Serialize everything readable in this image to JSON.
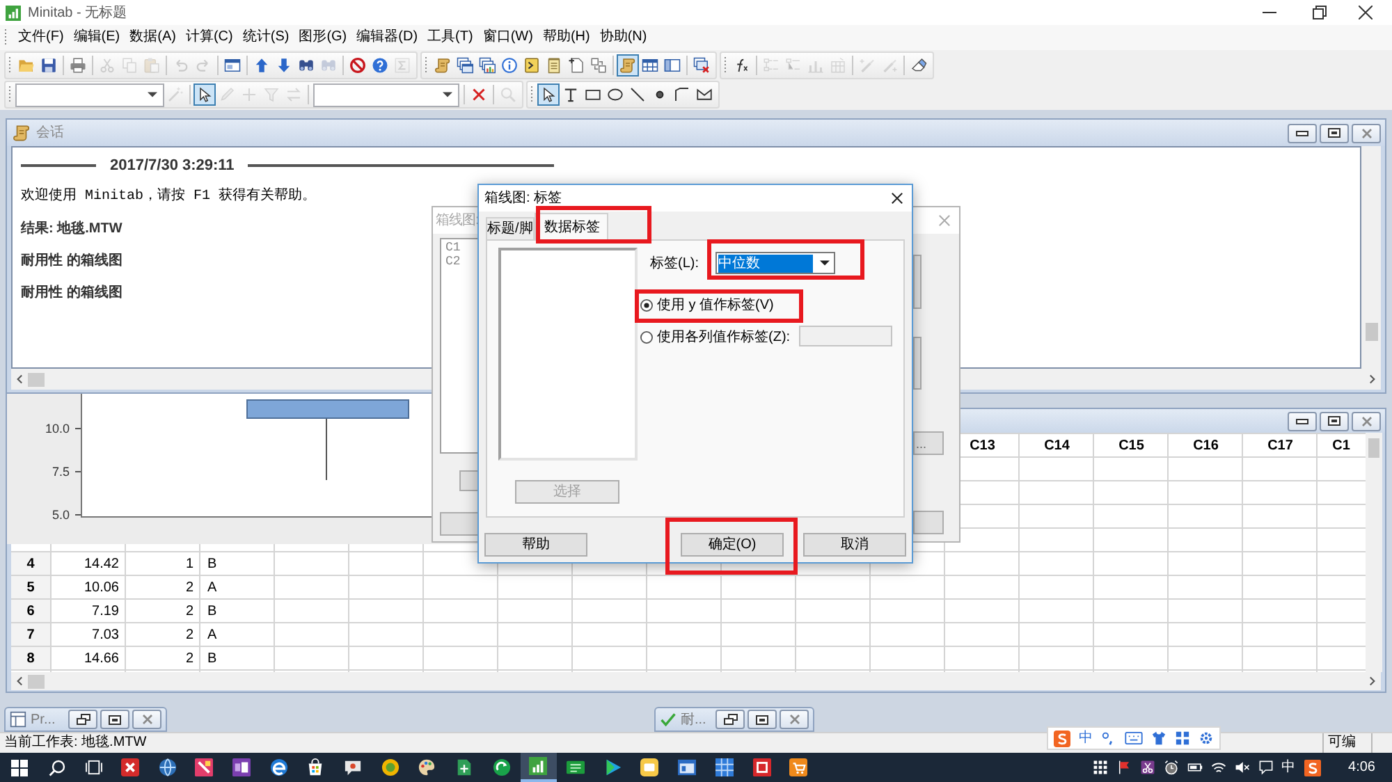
{
  "window": {
    "title": "Minitab - 无标题"
  },
  "menu": [
    "文件(F)",
    "编辑(E)",
    "数据(A)",
    "计算(C)",
    "统计(S)",
    "图形(G)",
    "编辑器(D)",
    "工具(T)",
    "窗口(W)",
    "帮助(H)",
    "协助(N)"
  ],
  "toolbars": [
    {
      "buttons": [
        {
          "disabled": false,
          "pressed": false
        },
        {
          "disabled": false,
          "pressed": false
        },
        {
          "disabled": false,
          "pressed": false
        },
        {
          "disabled": true,
          "pressed": false
        },
        {
          "disabled": true,
          "pressed": false
        },
        {
          "disabled": true,
          "pressed": false
        },
        {
          "disabled": true,
          "pressed": false
        },
        {
          "disabled": true,
          "pressed": false
        },
        {
          "disabled": false,
          "pressed": false
        },
        {
          "disabled": false,
          "pressed": false
        },
        {
          "disabled": false,
          "pressed": false
        },
        {
          "disabled": false,
          "pressed": false
        },
        {
          "disabled": true,
          "pressed": false
        },
        {
          "disabled": false,
          "pressed": false
        },
        {
          "disabled": false,
          "pressed": false
        },
        {
          "disabled": true,
          "pressed": false
        },
        {
          "disabled": false,
          "pressed": false
        },
        {
          "disabled": false,
          "pressed": false
        },
        {
          "disabled": false,
          "pressed": false
        },
        {
          "disabled": false,
          "pressed": false
        },
        {
          "disabled": false,
          "pressed": false
        },
        {
          "disabled": false,
          "pressed": false
        },
        {
          "disabled": false,
          "pressed": false
        },
        {
          "disabled": false,
          "pressed": false
        },
        {
          "disabled": false,
          "pressed": true
        },
        {
          "disabled": false,
          "pressed": false
        },
        {
          "disabled": false,
          "pressed": false
        },
        {
          "disabled": false,
          "pressed": false
        },
        {
          "disabled": false,
          "pressed": false
        },
        {
          "disabled": true,
          "pressed": false
        },
        {
          "disabled": true,
          "pressed": false
        },
        {
          "disabled": true,
          "pressed": false
        },
        {
          "disabled": true,
          "pressed": false
        },
        {
          "disabled": true,
          "pressed": false
        },
        {
          "disabled": true,
          "pressed": false
        },
        {
          "disabled": false,
          "pressed": false
        }
      ]
    },
    {
      "buttons": [
        {
          "disabled": true,
          "pressed": false
        },
        {
          "disabled": false,
          "pressed": true
        },
        {
          "disabled": true,
          "pressed": false
        },
        {
          "disabled": true,
          "pressed": false
        },
        {
          "disabled": true,
          "pressed": false
        },
        {
          "disabled": true,
          "pressed": false
        },
        {
          "disabled": false,
          "pressed": false
        },
        {
          "disabled": true,
          "pressed": false
        },
        {
          "disabled": false,
          "pressed": true
        },
        {
          "disabled": false,
          "pressed": false
        },
        {
          "disabled": false,
          "pressed": false
        },
        {
          "disabled": false,
          "pressed": false
        },
        {
          "disabled": false,
          "pressed": false
        },
        {
          "disabled": false,
          "pressed": false
        },
        {
          "disabled": false,
          "pressed": false
        },
        {
          "disabled": false,
          "pressed": false
        }
      ]
    }
  ],
  "session": {
    "title": "会话",
    "timestamp": "2017/7/30 3:29:11",
    "lines": [
      {
        "kind": "note",
        "text": "欢迎使用 Minitab，请按 F1 获得有关帮助。"
      },
      {
        "kind": "heading",
        "text": "结果: 地毯.MTW"
      },
      {
        "kind": "heading",
        "text": "耐用性 的箱线图"
      },
      {
        "kind": "heading",
        "text": "耐用性 的箱线图"
      }
    ]
  },
  "graph": {
    "ticks": [
      "10.0",
      "7.5",
      "5.0"
    ]
  },
  "worksheet": {
    "columns": [
      "C13",
      "C14",
      "C15",
      "C16",
      "C17",
      "C1"
    ],
    "rows": [
      {
        "number": "4",
        "cells": [
          "14.42",
          "1",
          "B"
        ]
      },
      {
        "number": "5",
        "cells": [
          "10.06",
          "2",
          "A"
        ]
      },
      {
        "number": "6",
        "cells": [
          "7.19",
          "2",
          "B"
        ]
      },
      {
        "number": "7",
        "cells": [
          "7.03",
          "2",
          "A"
        ]
      },
      {
        "number": "8",
        "cells": [
          "14.66",
          "2",
          "B"
        ]
      }
    ]
  },
  "back_dialog": {
    "title": "箱线图:",
    "list": [
      "C1",
      "C2"
    ],
    "button": "..."
  },
  "dialog": {
    "title": "箱线图: 标签",
    "tabs": [
      {
        "label": "标题/脚",
        "selected": false
      },
      {
        "label": "数据标签",
        "selected": true
      }
    ],
    "select_button": {
      "label": "选择",
      "disabled": true
    },
    "label_field": {
      "label": "标签(L):",
      "value": "中位数"
    },
    "options": [
      {
        "label": "使用 y 值作标签(V)",
        "selected": true
      },
      {
        "label": "使用各列值作标签(Z):",
        "selected": false
      }
    ],
    "buttons": [
      "帮助",
      "确定(O)",
      "取消"
    ]
  },
  "minimized": [
    {
      "title": "Pr..."
    },
    {
      "title": "耐..."
    }
  ],
  "status_bar": {
    "text": "当前工作表: 地毯.MTW",
    "mode": "可编"
  },
  "ime_bar": {
    "mode": "中"
  },
  "taskbar": {
    "apps": [
      {
        "selected": false
      },
      {
        "selected": false
      },
      {
        "selected": false
      },
      {
        "selected": false
      },
      {
        "selected": false
      },
      {
        "selected": false
      },
      {
        "selected": false
      },
      {
        "selected": false
      },
      {
        "selected": false
      },
      {
        "selected": false
      },
      {
        "selected": false
      },
      {
        "selected": true
      },
      {
        "selected": false
      },
      {
        "selected": false
      },
      {
        "selected": false
      },
      {
        "selected": false
      },
      {
        "selected": false
      },
      {
        "selected": false
      },
      {
        "selected": false
      }
    ],
    "ime": "中",
    "time": "4:06"
  }
}
